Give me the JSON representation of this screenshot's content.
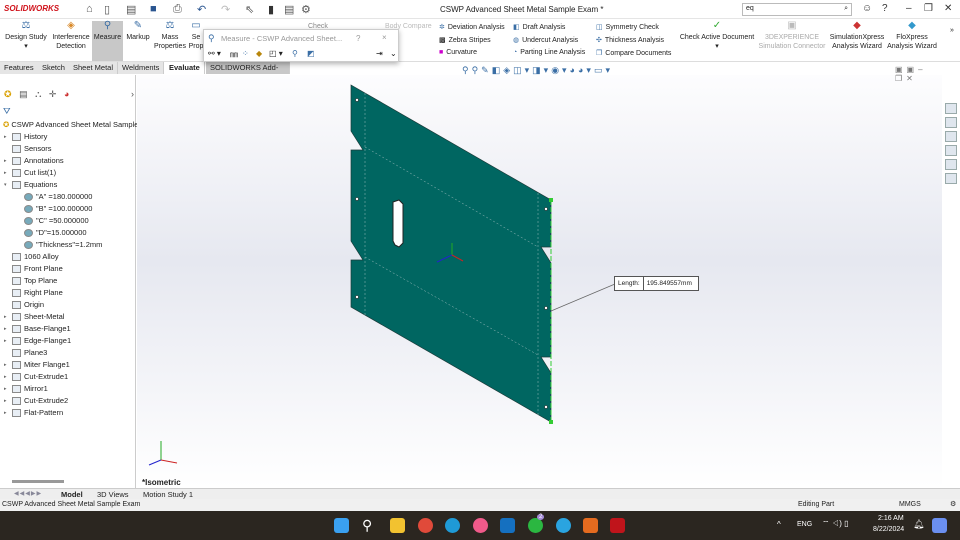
{
  "app": {
    "logo": "SOLIDWORKS",
    "title": "CSWP Advanced Sheet Metal Sample Exam *",
    "search_value": "eq"
  },
  "ribbon": {
    "big_buttons": [
      {
        "label": "Design Study"
      },
      {
        "label": "Interference Detection"
      },
      {
        "label": "Measure",
        "active": true
      },
      {
        "label": "Markup"
      },
      {
        "label": "Mass Properties"
      },
      {
        "label": "Se Prop"
      }
    ],
    "hidden": [
      "Check",
      "Body Compare"
    ],
    "col1": [
      "Deviation Analysis",
      "Zebra Stripes",
      "Curvature"
    ],
    "col2": [
      "Draft Analysis",
      "Undercut Analysis",
      "Parting Line Analysis"
    ],
    "col3": [
      "Symmetry Check",
      "Thickness Analysis",
      "Compare Documents"
    ],
    "check_active": "Check Active Document",
    "right": [
      {
        "label": "3DEXPERIENCE Simulation Connector",
        "disabled": true
      },
      {
        "label": "SimulationXpress Analysis Wizard"
      },
      {
        "label": "FloXpress Analysis Wizard"
      }
    ]
  },
  "tabs": [
    "Features",
    "Sketch",
    "Sheet Metal",
    "Weldments",
    "Evaluate",
    "SOLIDWORKS Add-Ins"
  ],
  "measure_dialog": {
    "title": "Measure - CSWP Advanced Sheet...",
    "help": "?",
    "close": "×"
  },
  "tree": {
    "root": "CSWP Advanced Sheet Metal Sample",
    "items": [
      "History",
      "Sensors",
      "Annotations",
      "Cut list(1)",
      "Equations",
      "\"A\" =180.000000",
      "\"B\" =100.000000",
      "\"C\" =50.000000",
      "\"D\"=15.000000",
      "\"Thickness\"=1.2mm",
      "1060 Alloy",
      "Front Plane",
      "Top Plane",
      "Right Plane",
      "Origin",
      "Sheet-Metal",
      "Base-Flange1",
      "Edge-Flange1",
      "Plane3",
      "Miter Flange1",
      "Cut-Extrude1",
      "Mirror1",
      "Cut-Extrude2",
      "Flat-Pattern"
    ]
  },
  "viewport": {
    "callout_label": "Length:",
    "callout_value": "195.849557mm",
    "view_name": "*Isometric",
    "part_color": "#006661"
  },
  "bottom_tabs": [
    "Model",
    "3D Views",
    "Motion Study 1"
  ],
  "status": {
    "left": "CSWP Advanced Sheet Metal Sample Exam",
    "mode": "Editing Part",
    "units": "MMGS"
  },
  "taskbar": {
    "lang": "ENG",
    "time": "2:16 AM",
    "date": "8/22/2024",
    "badge": "2"
  }
}
